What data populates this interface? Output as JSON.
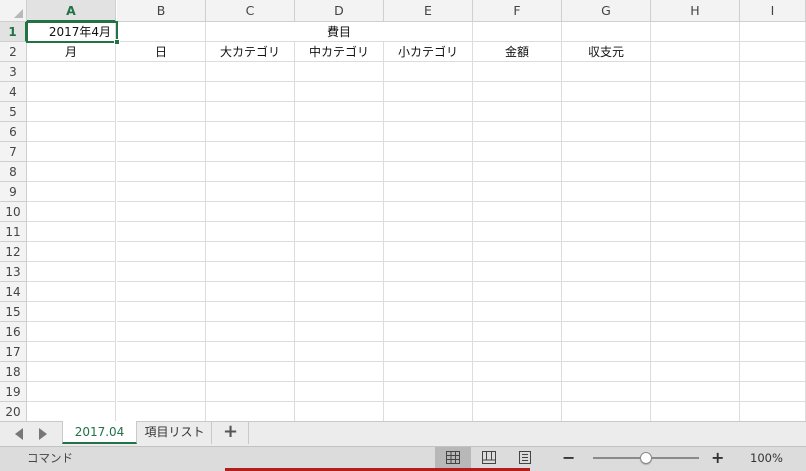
{
  "spreadsheet": {
    "columns": [
      "A",
      "B",
      "C",
      "D",
      "E",
      "F",
      "G",
      "H",
      "I"
    ],
    "selected_column": "A",
    "rows": [
      "1",
      "2",
      "3",
      "4",
      "5",
      "6",
      "7",
      "8",
      "9",
      "10",
      "11",
      "12",
      "13",
      "14",
      "15",
      "16",
      "17",
      "18",
      "19",
      "20"
    ],
    "selected_row": "1",
    "cells": {
      "A1": "2017年4月",
      "D1": "費目",
      "A2": "月",
      "B2": "日",
      "C2": "大カテゴリ",
      "D2": "中カテゴリ",
      "E2": "小カテゴリ",
      "F2": "金額",
      "G2": "収支元"
    },
    "active_cell": "A1"
  },
  "tabs": {
    "sheets": [
      "2017.04",
      "項目リスト"
    ],
    "active": "2017.04",
    "add_label": "+"
  },
  "status": {
    "mode": "コマンド",
    "zoom": "100%",
    "zoom_value": 100
  },
  "colors": {
    "accent": "#217346",
    "header_bg": "#f3f3f3",
    "grid_line": "#dcdcdc",
    "status_bg": "#dcdcdc"
  },
  "icons": [
    "tab-scroll-left-icon",
    "tab-scroll-right-icon",
    "normal-view-icon",
    "page-layout-view-icon",
    "page-break-view-icon"
  ]
}
